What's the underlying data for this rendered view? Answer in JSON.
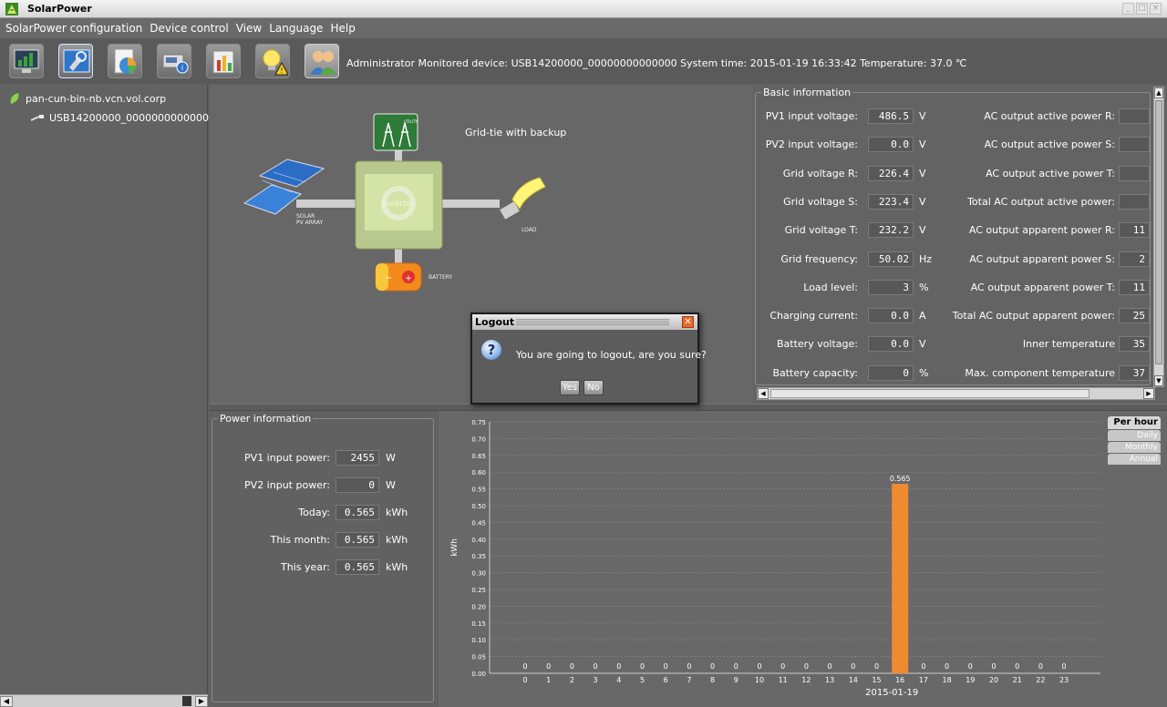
{
  "window": {
    "title": "SolarPower"
  },
  "menu": [
    "SolarPower configuration",
    "Device control",
    "View",
    "Language",
    "Help"
  ],
  "toolbar": {
    "buttons": [
      "monitor-icon",
      "configuration-icon",
      "data-analysis-icon",
      "device-info-icon",
      "event-log-icon",
      "warning-icon",
      "user-icon"
    ],
    "status": "Administrator  Monitored device: USB14200000_00000000000000  System time: 2015-01-19 16:33:42  Temperature: 37.0 ℃"
  },
  "tree": {
    "root": "pan-cun-bin-nb.vcn.vol.corp",
    "child": "USB14200000_0000000000000"
  },
  "diagram": {
    "mode": "Grid-tie with backup",
    "utility_label": "UTILITY",
    "inverter_label": "Inverter",
    "solar_label_1": "SOLAR",
    "solar_label_2": "PV ARRAY",
    "load_label": "LOAD",
    "battery_label": "BATTERY"
  },
  "basic_info": {
    "title": "Basic information",
    "left": [
      {
        "label": "PV1 input voltage:",
        "value": "486.5",
        "unit": "V"
      },
      {
        "label": "PV2 input voltage:",
        "value": "0.0",
        "unit": "V"
      },
      {
        "label": "Grid voltage R:",
        "value": "226.4",
        "unit": "V"
      },
      {
        "label": "Grid voltage S:",
        "value": "223.4",
        "unit": "V"
      },
      {
        "label": "Grid voltage T:",
        "value": "232.2",
        "unit": "V"
      },
      {
        "label": "Grid frequency:",
        "value": "50.02",
        "unit": "Hz"
      },
      {
        "label": "Load level:",
        "value": "3",
        "unit": "%"
      },
      {
        "label": "Charging current:",
        "value": "0.0",
        "unit": "A"
      },
      {
        "label": "Battery voltage:",
        "value": "0.0",
        "unit": "V"
      },
      {
        "label": "Battery capacity:",
        "value": "0",
        "unit": "%"
      }
    ],
    "right": [
      {
        "label": "AC output active power R:",
        "value": ""
      },
      {
        "label": "AC output active power S:",
        "value": ""
      },
      {
        "label": "AC output active power T:",
        "value": ""
      },
      {
        "label": "Total AC output active power:",
        "value": ""
      },
      {
        "label": "AC output apparent power R:",
        "value": "11"
      },
      {
        "label": "AC output apparent power S:",
        "value": "2"
      },
      {
        "label": "AC output apparent power T:",
        "value": "11"
      },
      {
        "label": "Total AC output apparent power:",
        "value": "25"
      },
      {
        "label": "Inner temperature",
        "value": "35"
      },
      {
        "label": "Max. component temperature",
        "value": "37"
      }
    ]
  },
  "power_info": {
    "title": "Power information",
    "rows": [
      {
        "label": "PV1 input power:",
        "value": "2455",
        "unit": "W"
      },
      {
        "label": "PV2 input power:",
        "value": "0",
        "unit": "W"
      },
      {
        "label": "Today:",
        "value": "0.565",
        "unit": "kWh"
      },
      {
        "label": "This month:",
        "value": "0.565",
        "unit": "kWh"
      },
      {
        "label": "This year:",
        "value": "0.565",
        "unit": "kWh"
      }
    ]
  },
  "chart_tabs": [
    "Per hour",
    "Daily",
    "Monthly",
    "Annual"
  ],
  "dialog": {
    "title": "Logout",
    "message": "You are going to logout, are you sure?",
    "yes": "Yes",
    "no": "No"
  },
  "colors": {
    "bar": "#f08a30",
    "panel": "#656565",
    "text": "#ffffff"
  },
  "chart_data": {
    "type": "bar",
    "categories": [
      "0",
      "1",
      "2",
      "3",
      "4",
      "5",
      "6",
      "7",
      "8",
      "9",
      "10",
      "11",
      "12",
      "13",
      "14",
      "15",
      "16",
      "17",
      "18",
      "19",
      "20",
      "21",
      "22",
      "23"
    ],
    "values": [
      0,
      0,
      0,
      0,
      0,
      0,
      0,
      0,
      0,
      0,
      0,
      0,
      0,
      0,
      0,
      0,
      0.565,
      0,
      0,
      0,
      0,
      0,
      0,
      0
    ],
    "data_labels": [
      "0",
      "0",
      "0",
      "0",
      "0",
      "0",
      "0",
      "0",
      "0",
      "0",
      "0",
      "0",
      "0",
      "0",
      "0",
      "0",
      "0.565",
      "0",
      "0",
      "0",
      "0",
      "0",
      "0",
      "0"
    ],
    "xlabel": "2015-01-19",
    "ylabel": "kWh",
    "ylim": [
      0,
      0.75
    ],
    "yticks": [
      "0.00",
      "0.05",
      "0.10",
      "0.15",
      "0.20",
      "0.25",
      "0.30",
      "0.35",
      "0.40",
      "0.45",
      "0.50",
      "0.55",
      "0.60",
      "0.65",
      "0.70",
      "0.75"
    ],
    "grid": true
  }
}
